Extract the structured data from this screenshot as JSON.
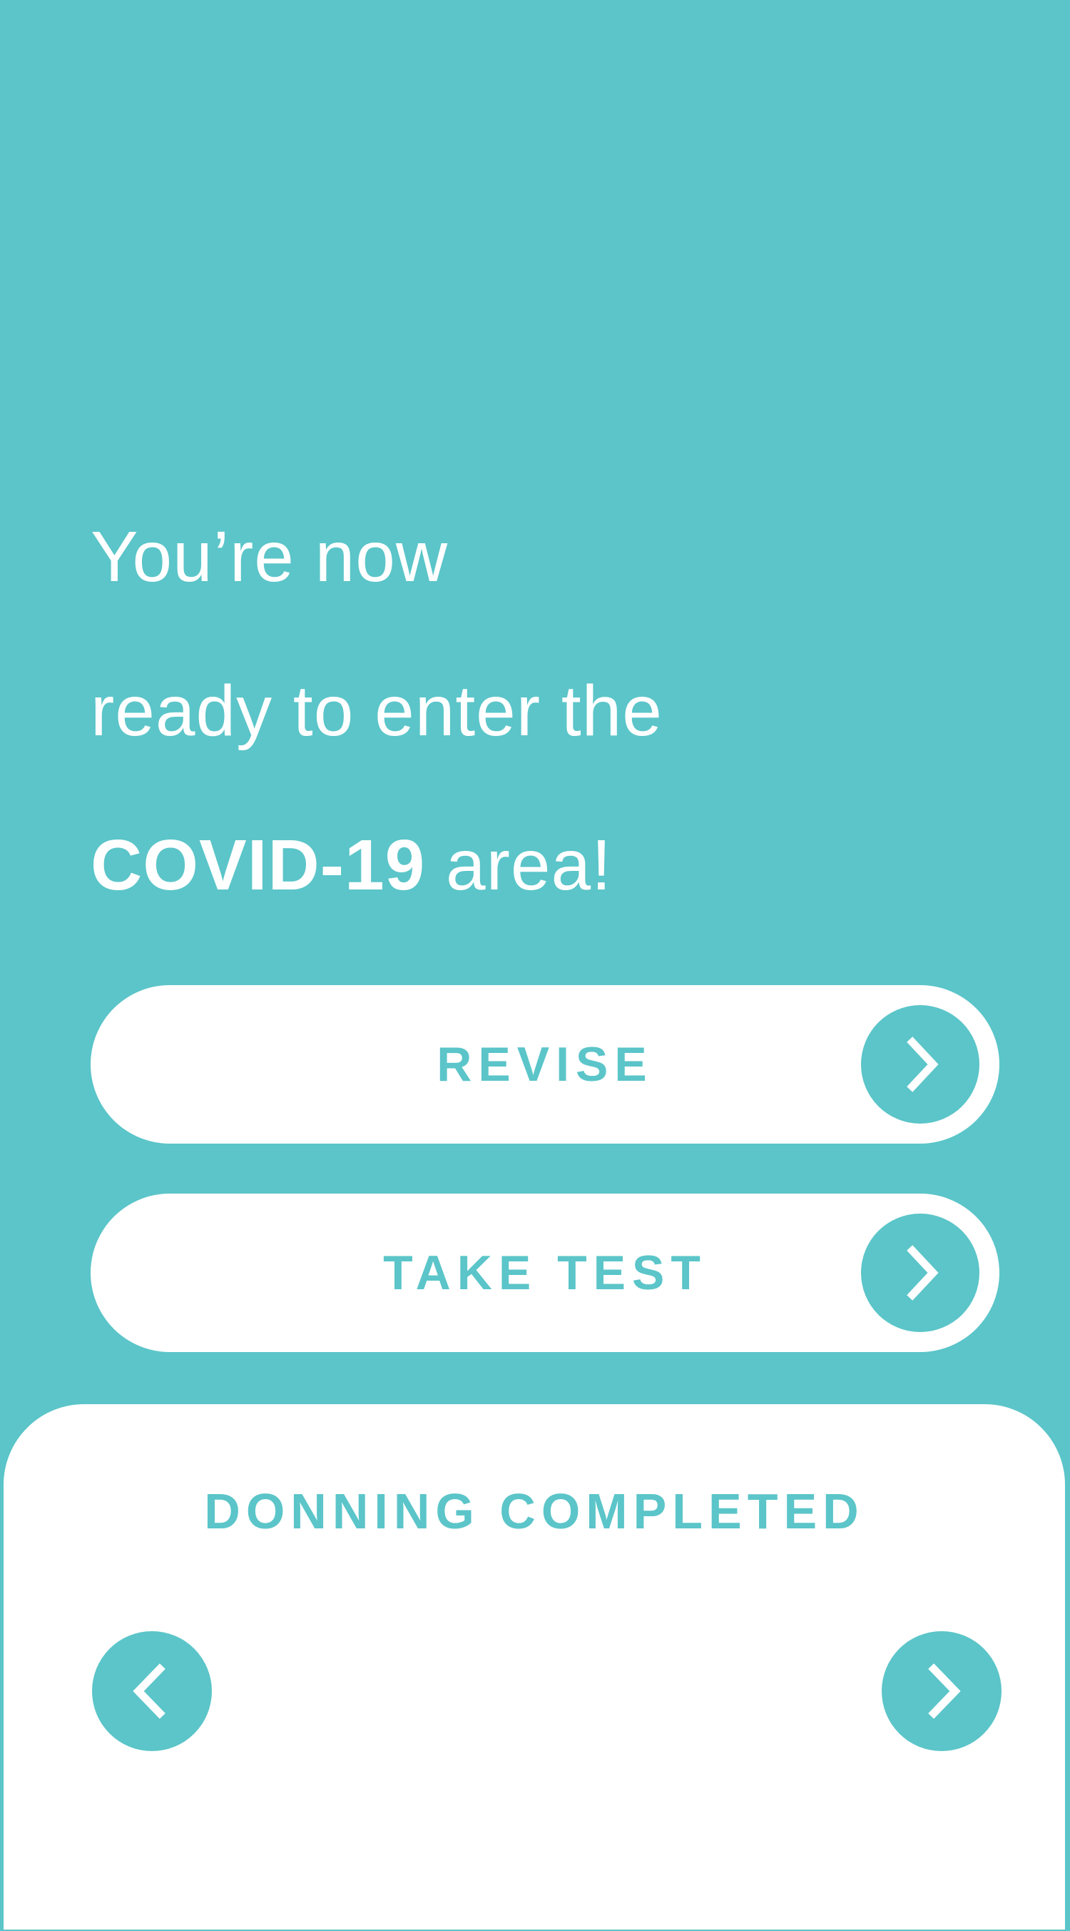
{
  "headline": {
    "line1": "You’re now",
    "line2": "ready to enter the",
    "line3_bold": "COVID-19",
    "line3_rest": " area!"
  },
  "buttons": {
    "revise_label": "REVISE",
    "take_test_label": "TAKE TEST"
  },
  "card": {
    "title": "DONNING COMPLETED"
  },
  "icons": {
    "pill_arrow": "chevron-right-icon",
    "prev": "chevron-left-icon",
    "next": "chevron-right-icon"
  },
  "colors": {
    "accent": "#5bc5c9",
    "surface": "#ffffff"
  }
}
